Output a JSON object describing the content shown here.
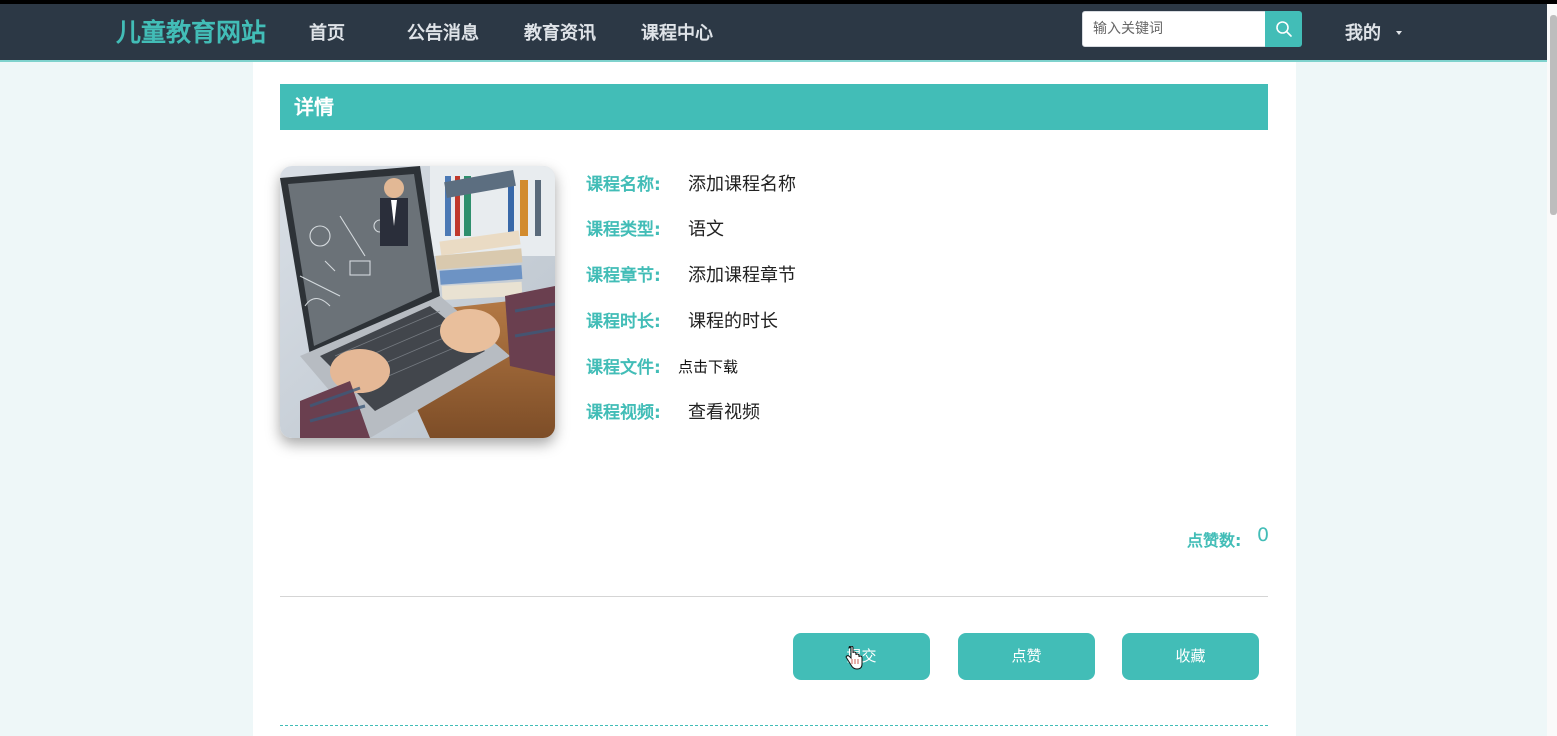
{
  "brand": "儿童教育网站",
  "nav": [
    "首页",
    "公告消息",
    "教育资讯",
    "课程中心"
  ],
  "search": {
    "placeholder": "输入关键词"
  },
  "user_menu": "我的",
  "detail": {
    "title": "详情",
    "rows": [
      {
        "label": "课程名称:",
        "value": "添加课程名称"
      },
      {
        "label": "课程类型:",
        "value": "语文"
      },
      {
        "label": "课程章节:",
        "value": "添加课程章节"
      },
      {
        "label": "课程时长:",
        "value": "课程的时长"
      },
      {
        "label": "课程文件:",
        "value": "点击下载"
      },
      {
        "label": "课程视频:",
        "value": "查看视频"
      }
    ],
    "like_count_label": "点赞数:",
    "like_count": "0"
  },
  "actions": {
    "submit": "提交",
    "like": "点赞",
    "favorite": "收藏"
  },
  "colors": {
    "accent": "#42bdb7",
    "nav_bg": "#2c3845",
    "page_bg": "#eef7f8"
  },
  "icons": [
    "search-icon",
    "chevron-down-icon",
    "pointer-cursor-icon"
  ]
}
